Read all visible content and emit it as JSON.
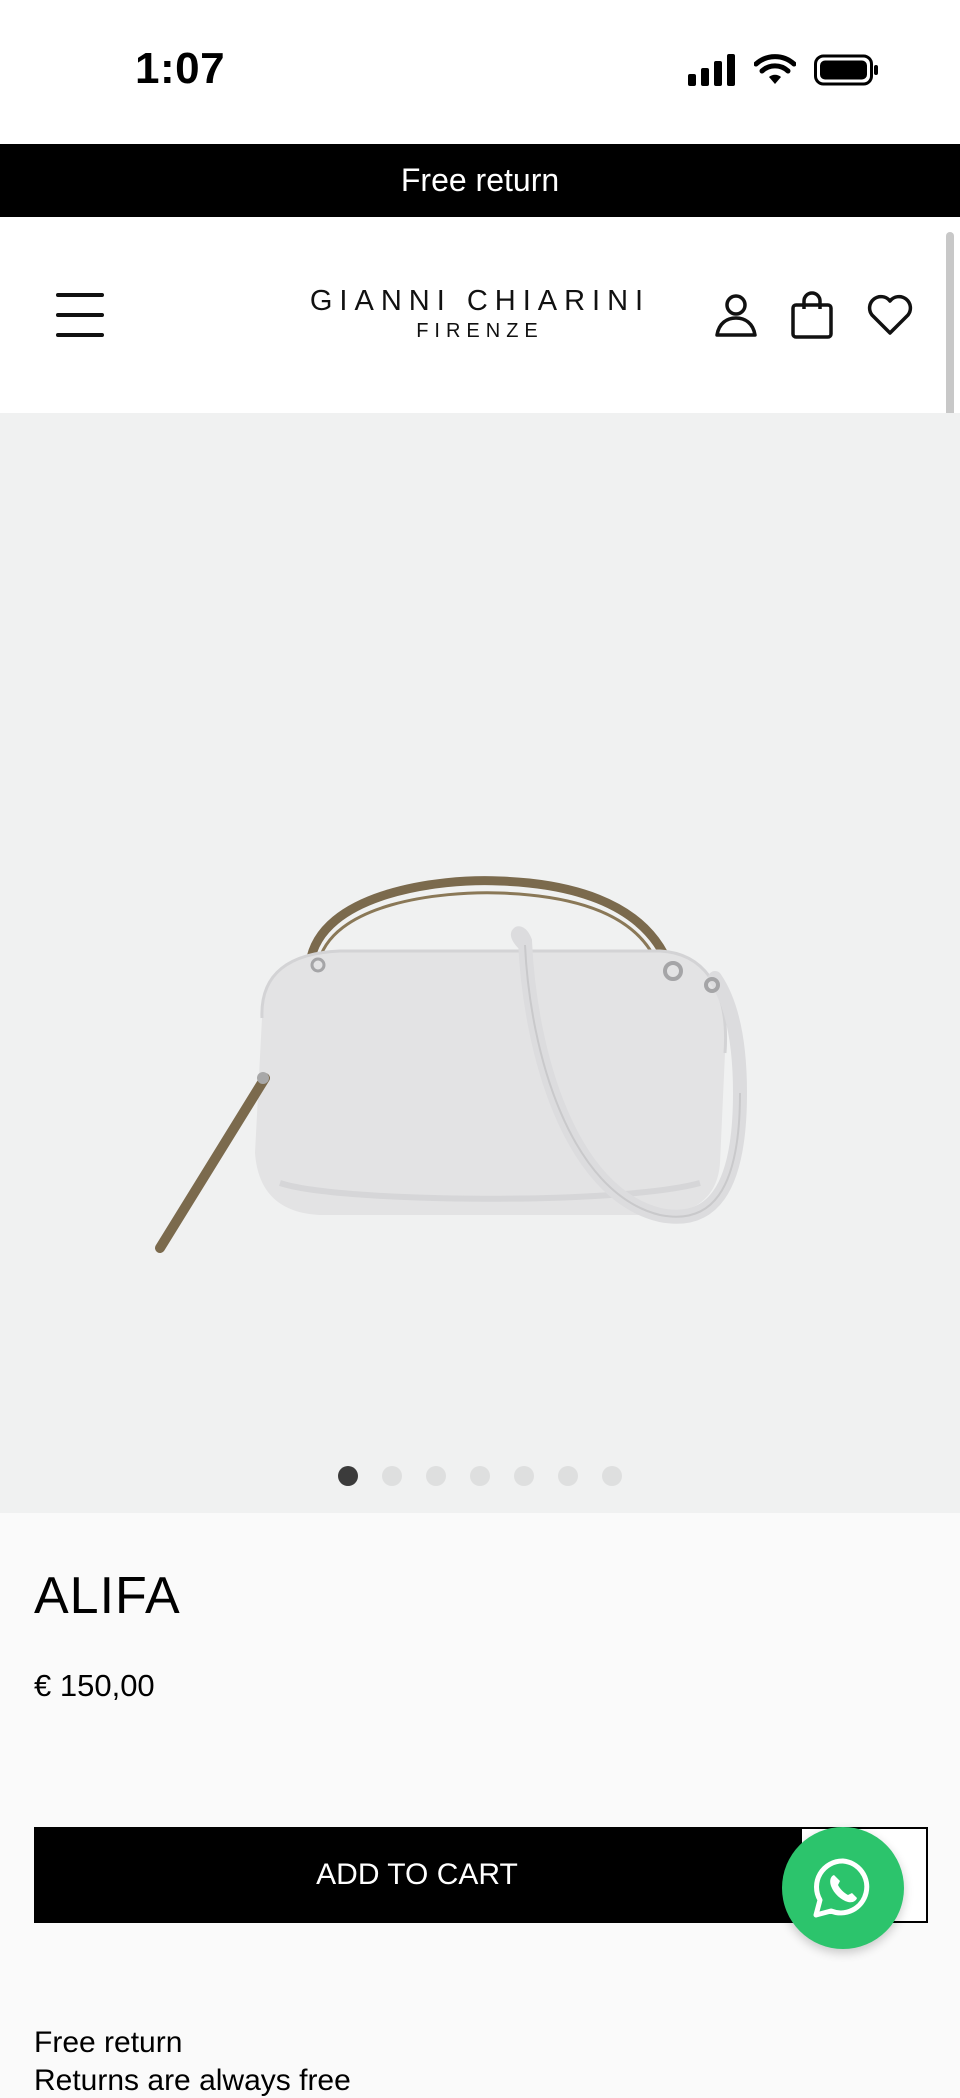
{
  "status_bar": {
    "time": "1:07",
    "icons": [
      "signal-icon",
      "wifi-icon",
      "battery-icon"
    ]
  },
  "promo": {
    "text": "Free return"
  },
  "header": {
    "brand_line1": "GIANNI CHIARINI",
    "brand_line2": "FIRENZE",
    "icons": [
      "menu-icon",
      "account-icon",
      "shopping-bag-icon",
      "heart-icon"
    ]
  },
  "gallery": {
    "image": "white-leather-handbag",
    "background_color": "#f0f1f1",
    "slide_count": 7,
    "active_slide": 1
  },
  "product": {
    "name": "ALIFA",
    "price": "€ 150,00"
  },
  "actions": {
    "add_to_cart_label": "ADD TO CART"
  },
  "info": {
    "return_title": "Free return",
    "return_text": "Returns are always free"
  },
  "colors": {
    "whatsapp": "#2cc46c",
    "promo_bg": "#000000",
    "button_bg": "#000000"
  }
}
